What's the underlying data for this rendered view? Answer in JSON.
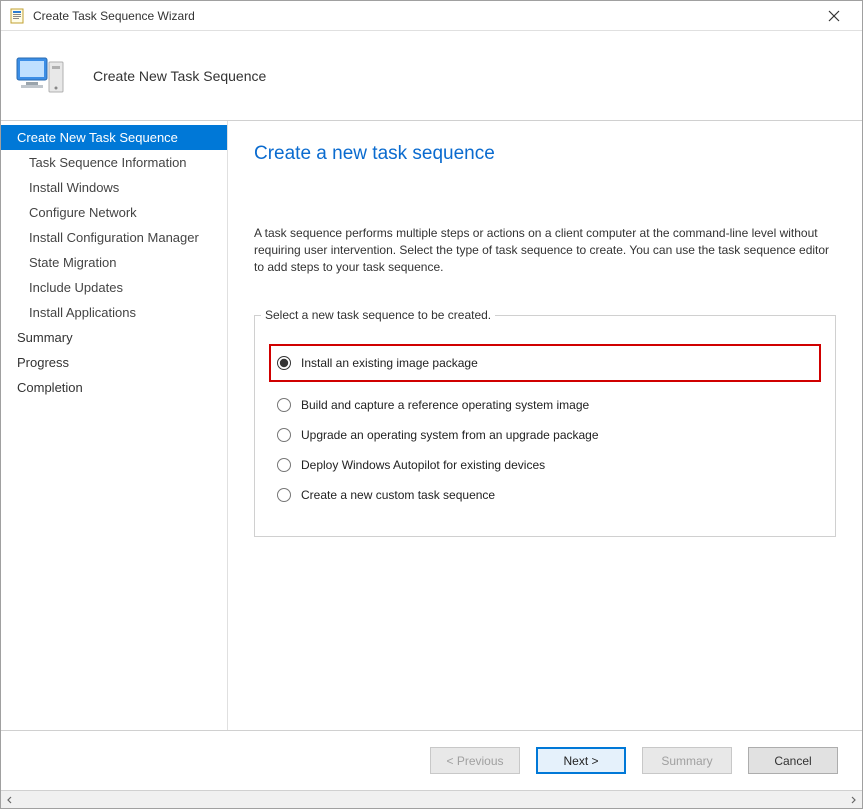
{
  "titlebar": {
    "title": "Create Task Sequence Wizard"
  },
  "header": {
    "subtitle": "Create New Task Sequence"
  },
  "sidebar": {
    "steps": [
      {
        "label": "Create New Task Sequence",
        "active": true,
        "sub": false
      },
      {
        "label": "Task Sequence Information",
        "active": false,
        "sub": true
      },
      {
        "label": "Install Windows",
        "active": false,
        "sub": true
      },
      {
        "label": "Configure Network",
        "active": false,
        "sub": true
      },
      {
        "label": "Install Configuration Manager",
        "active": false,
        "sub": true
      },
      {
        "label": "State Migration",
        "active": false,
        "sub": true
      },
      {
        "label": "Include Updates",
        "active": false,
        "sub": true
      },
      {
        "label": "Install Applications",
        "active": false,
        "sub": true
      },
      {
        "label": "Summary",
        "active": false,
        "sub": false
      },
      {
        "label": "Progress",
        "active": false,
        "sub": false
      },
      {
        "label": "Completion",
        "active": false,
        "sub": false
      }
    ]
  },
  "content": {
    "page_title": "Create a new task sequence",
    "description": "A task sequence performs multiple steps or actions on a client computer at the command-line level without requiring user intervention. Select the type of task sequence to create. You can use the task sequence editor to add steps to your task sequence.",
    "group_label": "Select a new task sequence to be created.",
    "options": [
      {
        "label": "Install an existing image package",
        "selected": true,
        "highlight": true
      },
      {
        "label": "Build and capture a reference operating system image",
        "selected": false,
        "highlight": false
      },
      {
        "label": "Upgrade an operating system from an upgrade package",
        "selected": false,
        "highlight": false
      },
      {
        "label": "Deploy Windows Autopilot for existing devices",
        "selected": false,
        "highlight": false
      },
      {
        "label": "Create a new custom task sequence",
        "selected": false,
        "highlight": false
      }
    ]
  },
  "footer": {
    "previous": "< Previous",
    "next": "Next >",
    "summary": "Summary",
    "cancel": "Cancel"
  }
}
